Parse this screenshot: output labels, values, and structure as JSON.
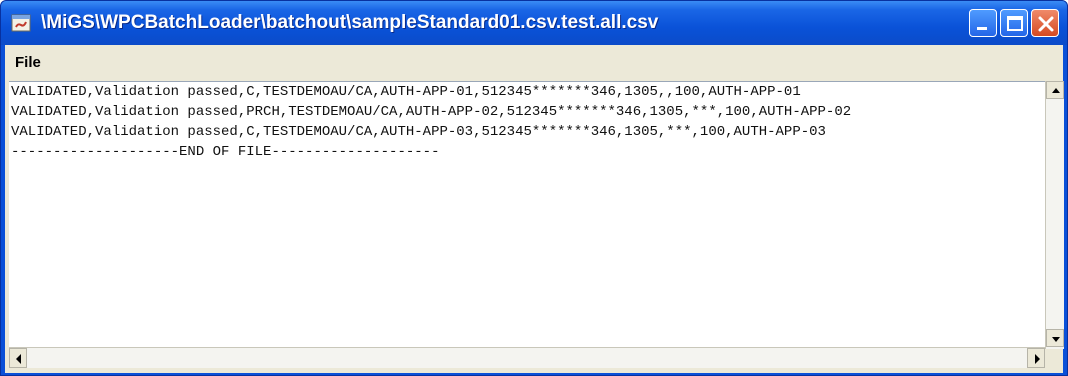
{
  "window": {
    "title": "\\MiGS\\WPCBatchLoader\\batchout\\sampleStandard01.csv.test.all.csv"
  },
  "menu": {
    "items": [
      "File"
    ]
  },
  "content": {
    "lines": [
      "VALIDATED,Validation passed,C,TESTDEMOAU/CA,AUTH-APP-01,512345*******346,1305,,100,AUTH-APP-01",
      "VALIDATED,Validation passed,PRCH,TESTDEMOAU/CA,AUTH-APP-02,512345*******346,1305,***,100,AUTH-APP-02",
      "VALIDATED,Validation passed,C,TESTDEMOAU/CA,AUTH-APP-03,512345*******346,1305,***,100,AUTH-APP-03",
      "--------------------END OF FILE--------------------"
    ]
  },
  "icons": {
    "app": "java-window-icon",
    "minimize": "minimize-icon",
    "maximize": "maximize-icon",
    "close": "close-icon",
    "scroll_up": "arrow-up-icon",
    "scroll_down": "arrow-down-icon",
    "scroll_left": "arrow-left-icon",
    "scroll_right": "arrow-right-icon"
  },
  "colors": {
    "titlebar": "#0a52d8",
    "close_button": "#d54a22",
    "client_bg": "#ece9d8"
  }
}
